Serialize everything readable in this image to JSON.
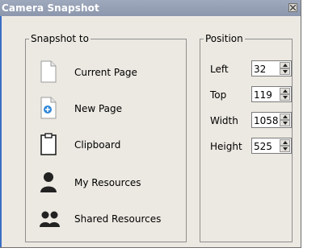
{
  "window": {
    "title": "Camera Snapshot",
    "close_glyph": "×"
  },
  "snapshot": {
    "legend": "Snapshot to",
    "items": [
      {
        "label": "Current Page",
        "icon": "page-icon"
      },
      {
        "label": "New Page",
        "icon": "new-page-icon"
      },
      {
        "label": "Clipboard",
        "icon": "clipboard-icon"
      },
      {
        "label": "My Resources",
        "icon": "person-icon"
      },
      {
        "label": "Shared Resources",
        "icon": "people-icon"
      }
    ]
  },
  "position": {
    "legend": "Position",
    "fields": [
      {
        "label": "Left",
        "value": "32"
      },
      {
        "label": "Top",
        "value": "119"
      },
      {
        "label": "Width",
        "value": "1058"
      },
      {
        "label": "Height",
        "value": "525"
      }
    ]
  },
  "colors": {
    "title_bar": "#8c97ad",
    "window_bg": "#ece9e2",
    "accent_blue": "#3b6dc4"
  }
}
